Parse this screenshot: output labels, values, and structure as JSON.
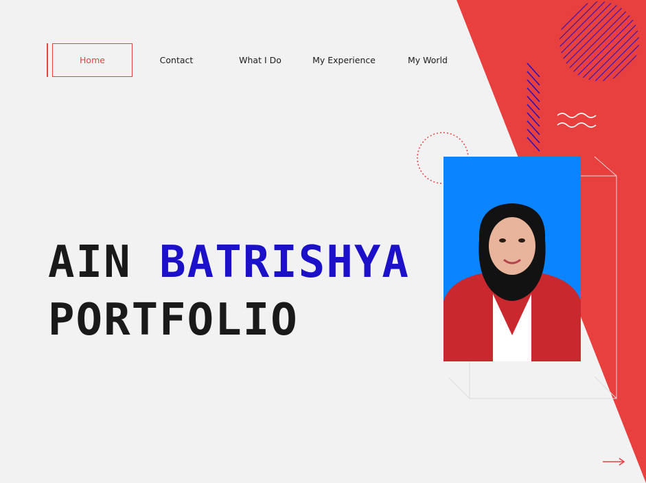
{
  "nav": {
    "items": [
      {
        "label": "Home",
        "active": true
      },
      {
        "label": "Contact",
        "active": false
      },
      {
        "label": "What I Do",
        "active": false
      },
      {
        "label": "My Experience",
        "active": false
      },
      {
        "label": "My World",
        "active": false
      }
    ]
  },
  "hero": {
    "name_first": "AIN",
    "name_last": "BATRISHYA",
    "subtitle": "PORTFOLIO"
  },
  "colors": {
    "accent_red": "#e83f3f",
    "accent_blue": "#1c10c9",
    "background": "#f2f2f2",
    "photo_bg": "#0a84ff"
  },
  "icons": [
    "striped-circle-icon",
    "wave-lines-icon",
    "dotted-circle-icon",
    "diagonal-stripes-icon",
    "next-arrow-icon"
  ]
}
